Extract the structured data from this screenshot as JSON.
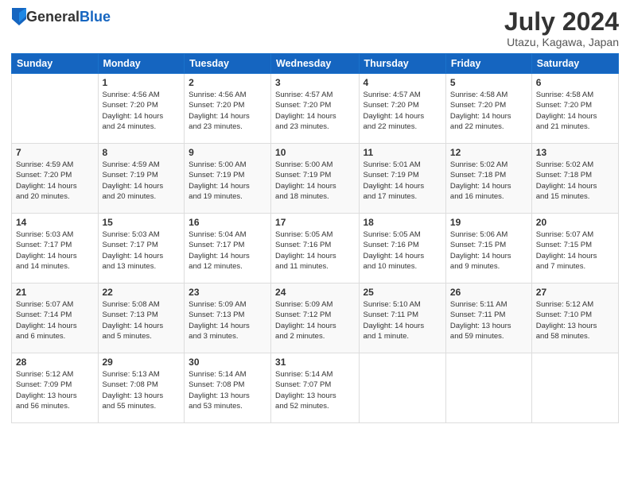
{
  "header": {
    "logo_general": "General",
    "logo_blue": "Blue",
    "month_title": "July 2024",
    "location": "Utazu, Kagawa, Japan"
  },
  "weekdays": [
    "Sunday",
    "Monday",
    "Tuesday",
    "Wednesday",
    "Thursday",
    "Friday",
    "Saturday"
  ],
  "weeks": [
    [
      {
        "day": "",
        "info": ""
      },
      {
        "day": "1",
        "info": "Sunrise: 4:56 AM\nSunset: 7:20 PM\nDaylight: 14 hours\nand 24 minutes."
      },
      {
        "day": "2",
        "info": "Sunrise: 4:56 AM\nSunset: 7:20 PM\nDaylight: 14 hours\nand 23 minutes."
      },
      {
        "day": "3",
        "info": "Sunrise: 4:57 AM\nSunset: 7:20 PM\nDaylight: 14 hours\nand 23 minutes."
      },
      {
        "day": "4",
        "info": "Sunrise: 4:57 AM\nSunset: 7:20 PM\nDaylight: 14 hours\nand 22 minutes."
      },
      {
        "day": "5",
        "info": "Sunrise: 4:58 AM\nSunset: 7:20 PM\nDaylight: 14 hours\nand 22 minutes."
      },
      {
        "day": "6",
        "info": "Sunrise: 4:58 AM\nSunset: 7:20 PM\nDaylight: 14 hours\nand 21 minutes."
      }
    ],
    [
      {
        "day": "7",
        "info": "Sunrise: 4:59 AM\nSunset: 7:20 PM\nDaylight: 14 hours\nand 20 minutes."
      },
      {
        "day": "8",
        "info": "Sunrise: 4:59 AM\nSunset: 7:19 PM\nDaylight: 14 hours\nand 20 minutes."
      },
      {
        "day": "9",
        "info": "Sunrise: 5:00 AM\nSunset: 7:19 PM\nDaylight: 14 hours\nand 19 minutes."
      },
      {
        "day": "10",
        "info": "Sunrise: 5:00 AM\nSunset: 7:19 PM\nDaylight: 14 hours\nand 18 minutes."
      },
      {
        "day": "11",
        "info": "Sunrise: 5:01 AM\nSunset: 7:19 PM\nDaylight: 14 hours\nand 17 minutes."
      },
      {
        "day": "12",
        "info": "Sunrise: 5:02 AM\nSunset: 7:18 PM\nDaylight: 14 hours\nand 16 minutes."
      },
      {
        "day": "13",
        "info": "Sunrise: 5:02 AM\nSunset: 7:18 PM\nDaylight: 14 hours\nand 15 minutes."
      }
    ],
    [
      {
        "day": "14",
        "info": "Sunrise: 5:03 AM\nSunset: 7:17 PM\nDaylight: 14 hours\nand 14 minutes."
      },
      {
        "day": "15",
        "info": "Sunrise: 5:03 AM\nSunset: 7:17 PM\nDaylight: 14 hours\nand 13 minutes."
      },
      {
        "day": "16",
        "info": "Sunrise: 5:04 AM\nSunset: 7:17 PM\nDaylight: 14 hours\nand 12 minutes."
      },
      {
        "day": "17",
        "info": "Sunrise: 5:05 AM\nSunset: 7:16 PM\nDaylight: 14 hours\nand 11 minutes."
      },
      {
        "day": "18",
        "info": "Sunrise: 5:05 AM\nSunset: 7:16 PM\nDaylight: 14 hours\nand 10 minutes."
      },
      {
        "day": "19",
        "info": "Sunrise: 5:06 AM\nSunset: 7:15 PM\nDaylight: 14 hours\nand 9 minutes."
      },
      {
        "day": "20",
        "info": "Sunrise: 5:07 AM\nSunset: 7:15 PM\nDaylight: 14 hours\nand 7 minutes."
      }
    ],
    [
      {
        "day": "21",
        "info": "Sunrise: 5:07 AM\nSunset: 7:14 PM\nDaylight: 14 hours\nand 6 minutes."
      },
      {
        "day": "22",
        "info": "Sunrise: 5:08 AM\nSunset: 7:13 PM\nDaylight: 14 hours\nand 5 minutes."
      },
      {
        "day": "23",
        "info": "Sunrise: 5:09 AM\nSunset: 7:13 PM\nDaylight: 14 hours\nand 3 minutes."
      },
      {
        "day": "24",
        "info": "Sunrise: 5:09 AM\nSunset: 7:12 PM\nDaylight: 14 hours\nand 2 minutes."
      },
      {
        "day": "25",
        "info": "Sunrise: 5:10 AM\nSunset: 7:11 PM\nDaylight: 14 hours\nand 1 minute."
      },
      {
        "day": "26",
        "info": "Sunrise: 5:11 AM\nSunset: 7:11 PM\nDaylight: 13 hours\nand 59 minutes."
      },
      {
        "day": "27",
        "info": "Sunrise: 5:12 AM\nSunset: 7:10 PM\nDaylight: 13 hours\nand 58 minutes."
      }
    ],
    [
      {
        "day": "28",
        "info": "Sunrise: 5:12 AM\nSunset: 7:09 PM\nDaylight: 13 hours\nand 56 minutes."
      },
      {
        "day": "29",
        "info": "Sunrise: 5:13 AM\nSunset: 7:08 PM\nDaylight: 13 hours\nand 55 minutes."
      },
      {
        "day": "30",
        "info": "Sunrise: 5:14 AM\nSunset: 7:08 PM\nDaylight: 13 hours\nand 53 minutes."
      },
      {
        "day": "31",
        "info": "Sunrise: 5:14 AM\nSunset: 7:07 PM\nDaylight: 13 hours\nand 52 minutes."
      },
      {
        "day": "",
        "info": ""
      },
      {
        "day": "",
        "info": ""
      },
      {
        "day": "",
        "info": ""
      }
    ]
  ]
}
